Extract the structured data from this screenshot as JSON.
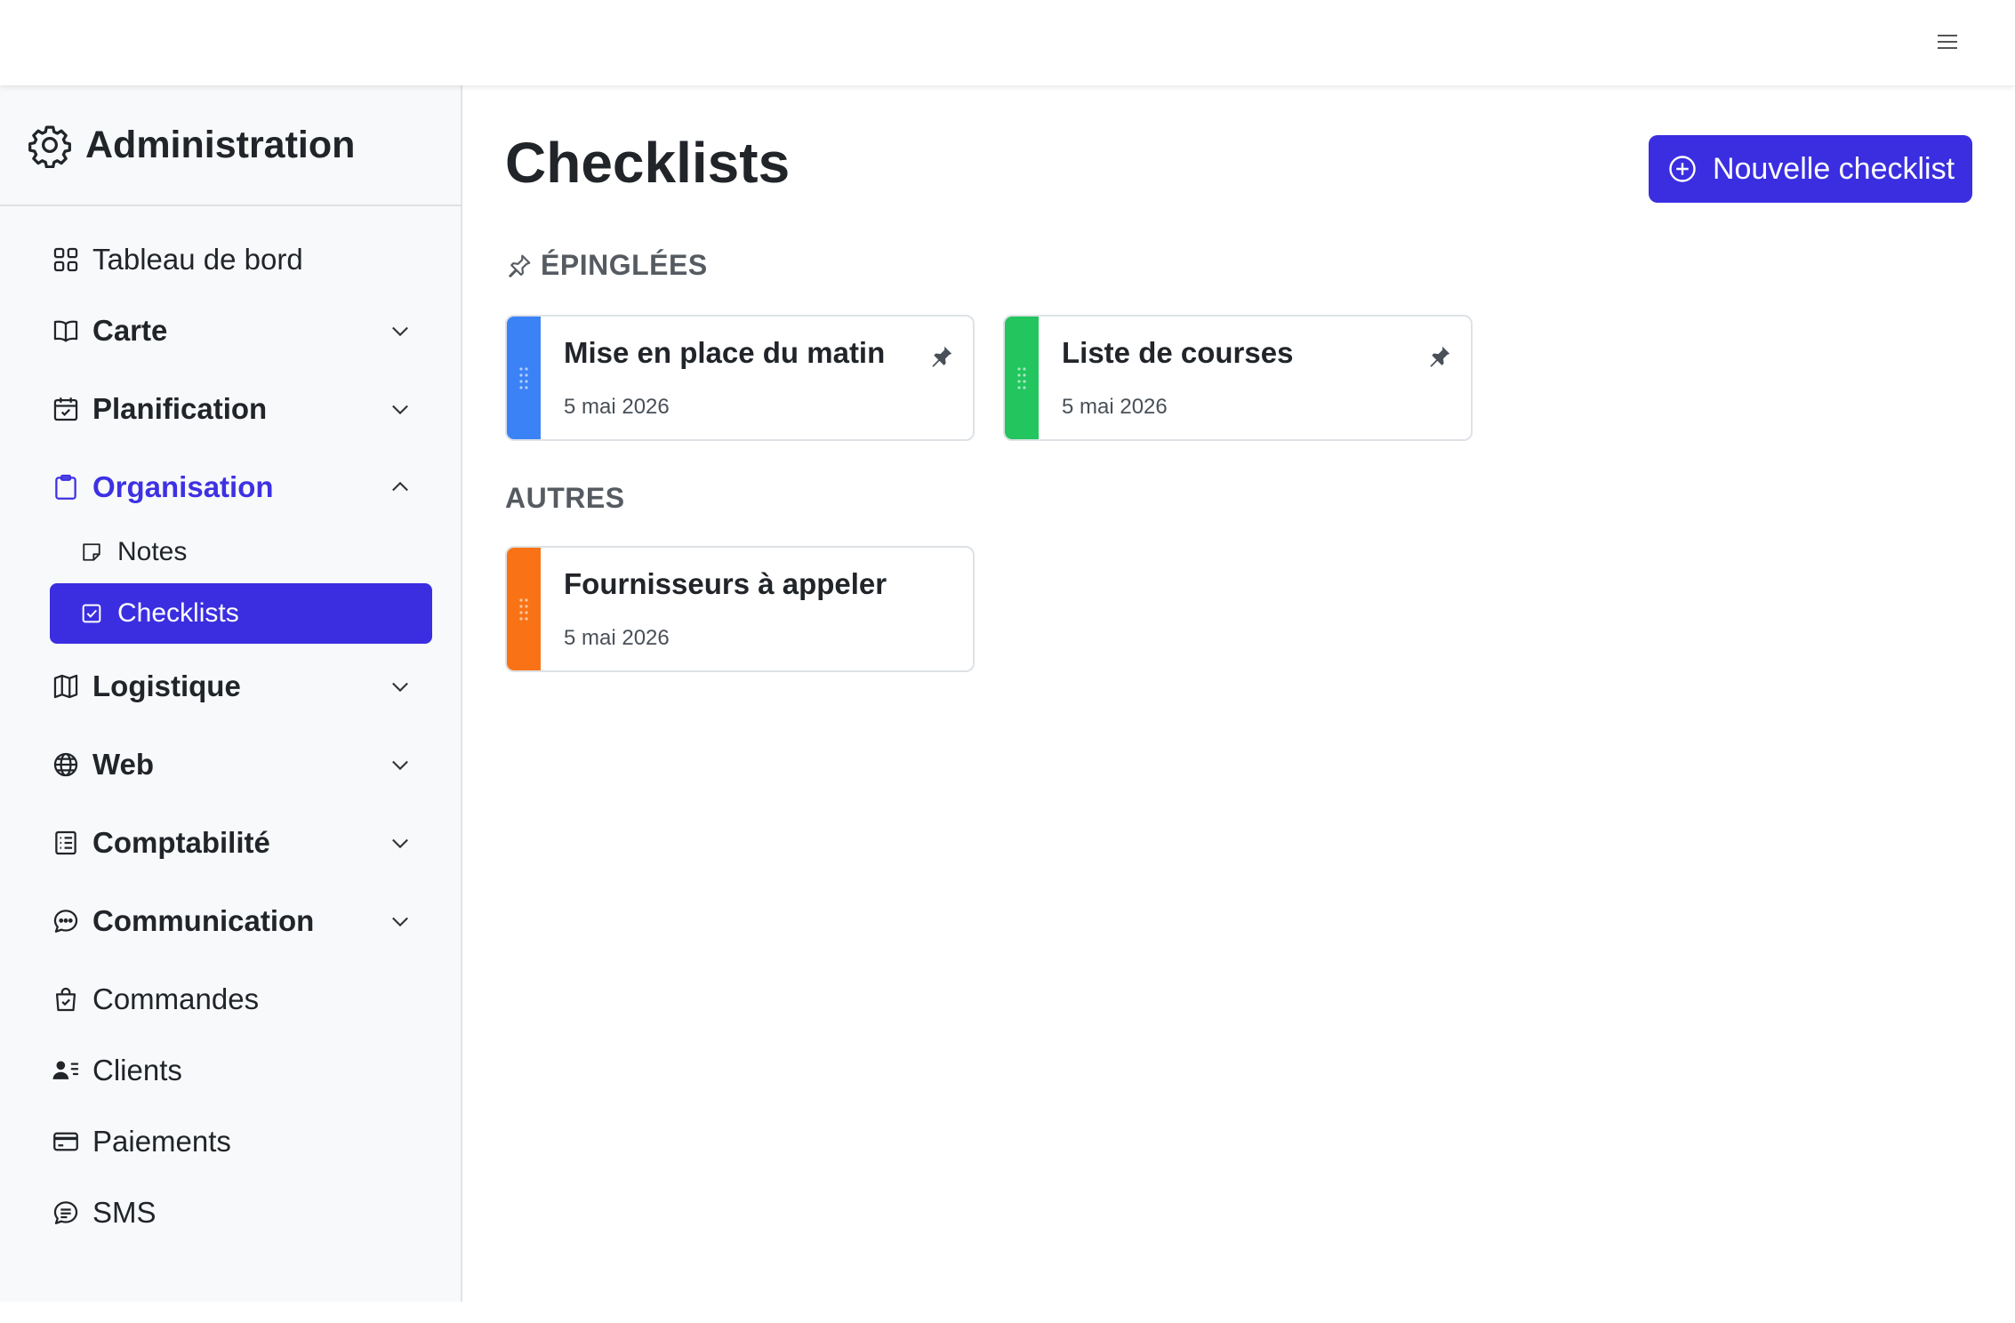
{
  "sidebar": {
    "brand": "Administration",
    "items": [
      {
        "label": "Tableau de bord"
      },
      {
        "label": "Carte"
      },
      {
        "label": "Planification"
      },
      {
        "label": "Organisation"
      },
      {
        "label": "Logistique"
      },
      {
        "label": "Web"
      },
      {
        "label": "Comptabilité"
      },
      {
        "label": "Communication"
      },
      {
        "label": "Commandes"
      },
      {
        "label": "Clients"
      },
      {
        "label": "Paiements"
      },
      {
        "label": "SMS"
      }
    ],
    "sub_items": [
      {
        "label": "Notes"
      },
      {
        "label": "Checklists"
      }
    ]
  },
  "main": {
    "title": "Checklists",
    "new_button": "Nouvelle checklist",
    "pinned_heading": "ÉPINGLÉES",
    "others_heading": "AUTRES",
    "pinned": [
      {
        "title": "Mise en place du matin",
        "date": "5 mai 2026",
        "color": "#3b82f6"
      },
      {
        "title": "Liste de courses",
        "date": "5 mai 2026",
        "color": "#22c55e"
      }
    ],
    "others": [
      {
        "title": "Fournisseurs à appeler",
        "date": "5 mai 2026",
        "color": "#f97316"
      }
    ]
  },
  "colors": {
    "accent": "#3a2ee0",
    "active_text": "#3d31e3"
  }
}
